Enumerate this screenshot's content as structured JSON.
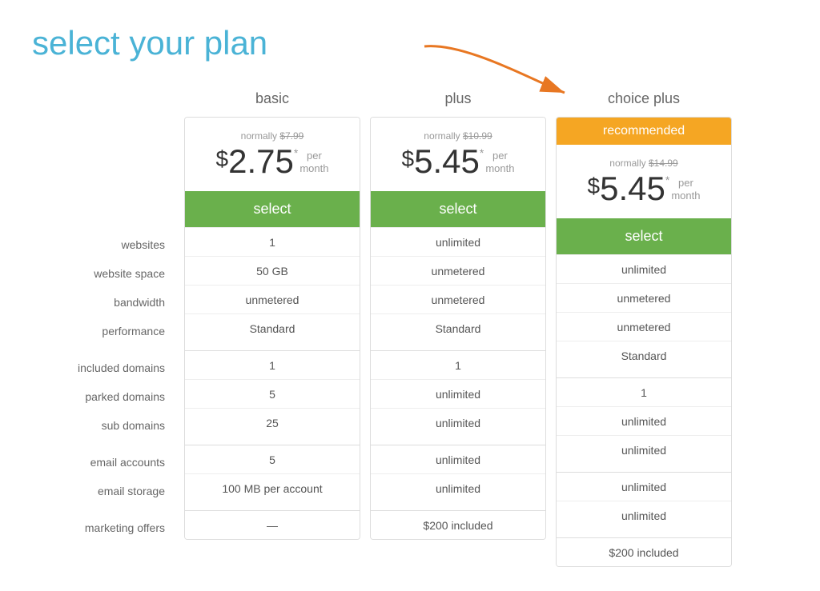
{
  "page": {
    "title": "select your plan"
  },
  "plans": [
    {
      "id": "basic",
      "name": "basic",
      "recommended": false,
      "normally_label": "normally",
      "normally_price": "$7.99",
      "price_dollar": "$",
      "price_amount": "2.75",
      "price_asterisk": "*",
      "price_per": "per\nmonth",
      "select_label": "select",
      "features": {
        "websites": "1",
        "website_space": "50 GB",
        "bandwidth": "unmetered",
        "performance": "Standard",
        "included_domains": "1",
        "parked_domains": "5",
        "sub_domains": "25",
        "email_accounts": "5",
        "email_storage": "100 MB per account",
        "marketing_offers": "—"
      }
    },
    {
      "id": "plus",
      "name": "plus",
      "recommended": false,
      "normally_label": "normally",
      "normally_price": "$10.99",
      "price_dollar": "$",
      "price_amount": "5.45",
      "price_asterisk": "*",
      "price_per": "per\nmonth",
      "select_label": "select",
      "features": {
        "websites": "unlimited",
        "website_space": "unmetered",
        "bandwidth": "unmetered",
        "performance": "Standard",
        "included_domains": "1",
        "parked_domains": "unlimited",
        "sub_domains": "unlimited",
        "email_accounts": "unlimited",
        "email_storage": "unlimited",
        "marketing_offers": "$200 included"
      }
    },
    {
      "id": "choice_plus",
      "name": "choice plus",
      "recommended": true,
      "recommended_label": "recommended",
      "normally_label": "normally",
      "normally_price": "$14.99",
      "price_dollar": "$",
      "price_amount": "5.45",
      "price_asterisk": "*",
      "price_per": "per\nmonth",
      "select_label": "select",
      "features": {
        "websites": "unlimited",
        "website_space": "unmetered",
        "bandwidth": "unmetered",
        "performance": "Standard",
        "included_domains": "1",
        "parked_domains": "unlimited",
        "sub_domains": "unlimited",
        "email_accounts": "unlimited",
        "email_storage": "unlimited",
        "marketing_offers": "$200 included"
      }
    }
  ],
  "feature_labels": [
    {
      "key": "websites",
      "label": "websites",
      "group_start": false
    },
    {
      "key": "website_space",
      "label": "website space",
      "group_start": false
    },
    {
      "key": "bandwidth",
      "label": "bandwidth",
      "group_start": false
    },
    {
      "key": "performance",
      "label": "performance",
      "group_start": false
    },
    {
      "key": "included_domains",
      "label": "included domains",
      "group_start": true
    },
    {
      "key": "parked_domains",
      "label": "parked domains",
      "group_start": false
    },
    {
      "key": "sub_domains",
      "label": "sub domains",
      "group_start": false
    },
    {
      "key": "email_accounts",
      "label": "email accounts",
      "group_start": true
    },
    {
      "key": "email_storage",
      "label": "email storage",
      "group_start": false
    },
    {
      "key": "marketing_offers",
      "label": "marketing offers",
      "group_start": true
    }
  ]
}
